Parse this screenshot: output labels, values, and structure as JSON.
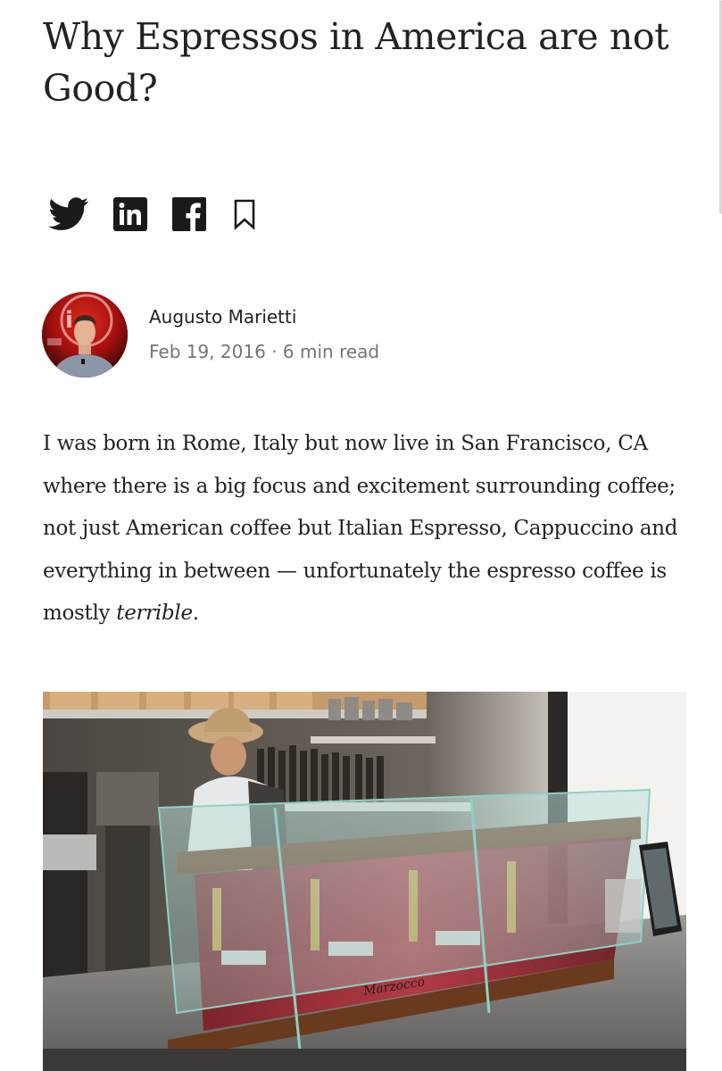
{
  "article": {
    "title": "Why Espressos in America are not Good?",
    "share": {
      "icons": [
        "twitter-icon",
        "linkedin-icon",
        "facebook-icon",
        "bookmark-icon"
      ]
    },
    "author": {
      "name": "Augusto Marietti",
      "date": "Feb 19, 2016",
      "separator": "·",
      "read_time": "6 min read"
    },
    "body": {
      "paragraph_main": "I was born in Rome, Italy but now live in San Francisco, CA where there is a big focus and excitement surrounding coffee; not just American coffee but Italian Espresso, Cappuccino and everything in between — unfortunately the espresso coffee is mostly ",
      "paragraph_emphasis": "terrible",
      "paragraph_end": "."
    },
    "photo": {
      "machine_brand": "Marzocco"
    }
  },
  "colors": {
    "text": "#222222",
    "meta": "#757575",
    "icon": "#1a1a1a"
  }
}
